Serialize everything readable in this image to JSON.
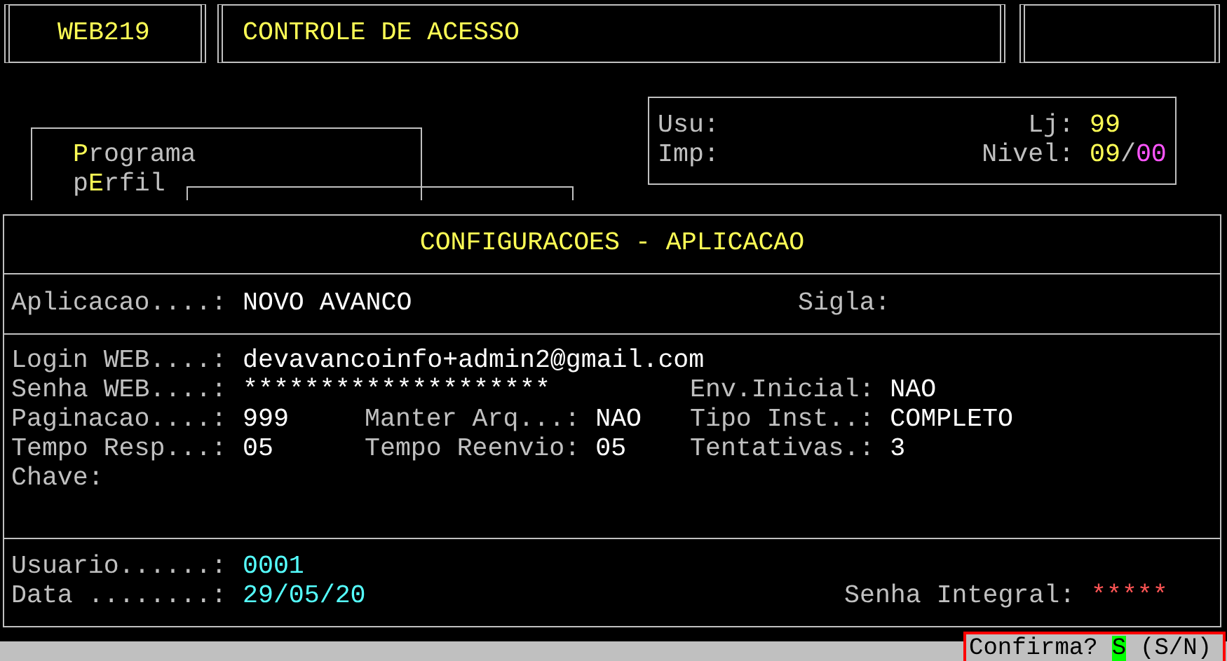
{
  "header": {
    "code": "WEB219",
    "title": "CONTROLE DE ACESSO"
  },
  "menu": [
    {
      "hotkey": "P",
      "after": "rograma"
    },
    {
      "before": "p",
      "hotkey": "E",
      "after": "rfil"
    }
  ],
  "session": {
    "usu_label": "Usu:",
    "imp_label": "Imp:",
    "lj_label": "Lj:",
    "lj_value": "99",
    "nivel_label": "Nivel:",
    "nivel_value": "09",
    "nivel_sep": "/",
    "nivel_sub": "00"
  },
  "panel": {
    "title": "CONFIGURACOES - APLICACAO",
    "application": {
      "label": "Aplicacao....:",
      "value": "NOVO AVANCO",
      "sigla_label": "Sigla:"
    },
    "fields": [
      {
        "col_1": {
          "label": "Login WEB....:",
          "value": "devavancoinfo+admin2@gmail.com"
        }
      },
      {
        "col_1": {
          "label": "Senha WEB....:",
          "value": "********************"
        },
        "col_3": {
          "label": "Env.Inicial:",
          "value": "NAO"
        }
      },
      {
        "col_1": {
          "label": "Paginacao....:",
          "value": "999"
        },
        "col_2": {
          "label": "Manter Arq...:",
          "value": "NAO"
        },
        "col_3": {
          "label": "Tipo Inst..:",
          "value": "COMPLETO"
        }
      },
      {
        "col_1": {
          "label": "Tempo Resp...:",
          "value": "05"
        },
        "col_2": {
          "label": "Tempo Reenvio:",
          "value": "05"
        },
        "col_3": {
          "label": "Tentativas.:",
          "value": "3"
        }
      },
      {
        "col_1": {
          "label": "Chave:"
        }
      }
    ],
    "footer": {
      "usuario": {
        "label": "Usuario......:",
        "value": "0001"
      },
      "data": {
        "label": "Data ........:",
        "value": "29/05/20"
      },
      "senha_integral": {
        "label": "Senha Integral:",
        "value": "*****"
      }
    }
  },
  "status": {
    "prompt": "Confirma?",
    "answer": "S",
    "options": "(S/N)"
  }
}
